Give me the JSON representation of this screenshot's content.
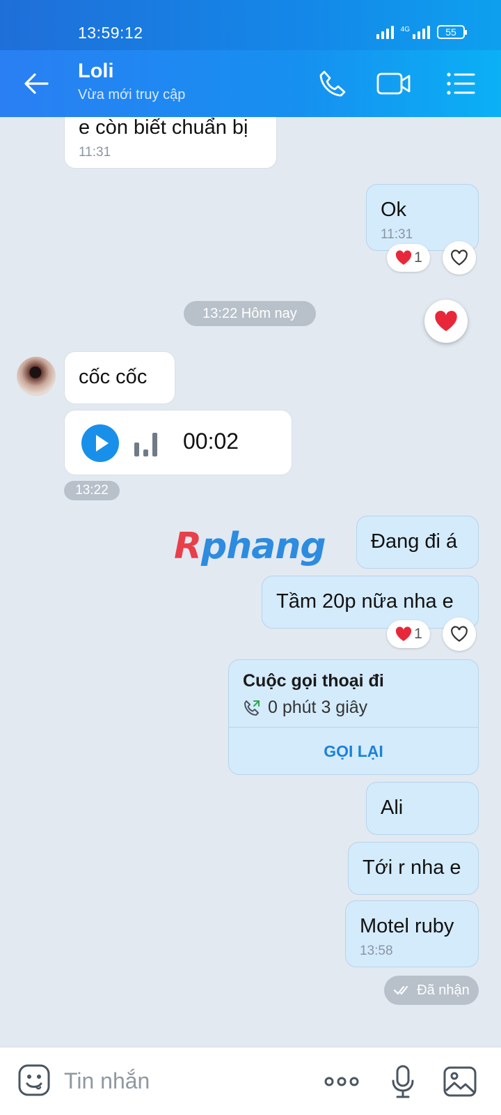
{
  "status_bar": {
    "time": "13:59:12",
    "network": "4G",
    "battery": "55"
  },
  "header": {
    "title": "Loli",
    "subtitle": "Vừa mới truy cập"
  },
  "messages": {
    "m1": {
      "text": "e còn biết chuẩn bị",
      "time": "11:31"
    },
    "m2": {
      "text": "Ok",
      "time": "11:31",
      "reaction_count": "1"
    },
    "date_pill": "13:22 Hôm nay",
    "m3": {
      "text": "cốc cốc"
    },
    "voice": {
      "duration": "00:02",
      "time": "13:22"
    },
    "m4": {
      "text": "Đang đi á"
    },
    "m5": {
      "text": "Tầm 20p nữa nha e",
      "reaction_count": "1"
    },
    "call": {
      "title": "Cuộc gọi thoại đi",
      "duration": "0 phút 3 giây",
      "action": "GỌI LẠI"
    },
    "m6": {
      "text": "Ali"
    },
    "m7": {
      "text": "Tới r nha e"
    },
    "m8": {
      "text": "Motel ruby",
      "time": "13:58"
    },
    "delivery_status": "Đã nhận"
  },
  "watermark": {
    "first": "R",
    "rest": "phang"
  },
  "composer": {
    "placeholder": "Tin nhắn"
  },
  "colors": {
    "header": "#1487e8",
    "outgoing": "#d4ebfc",
    "incoming": "#ffffff",
    "accent": "#1890ea",
    "heart": "#e8283a"
  }
}
